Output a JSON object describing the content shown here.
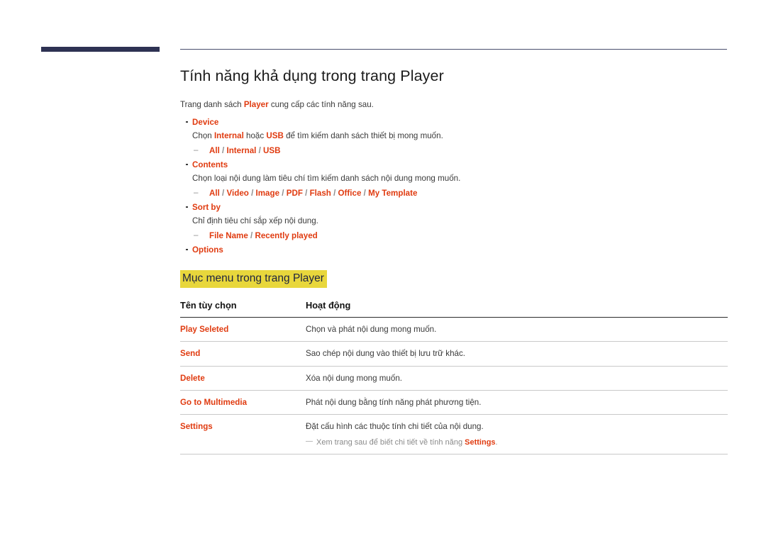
{
  "page": {
    "title": "Tính năng khả dụng trong trang Player",
    "intro_before": "Trang danh sách ",
    "intro_keyword": "Player",
    "intro_after": " cung cấp các tính năng sau."
  },
  "features": [
    {
      "title": "Device",
      "desc_parts": [
        {
          "text": "Chọn ",
          "style": "plain"
        },
        {
          "text": "Internal",
          "style": "red"
        },
        {
          "text": " hoặc ",
          "style": "plain"
        },
        {
          "text": "USB",
          "style": "red"
        },
        {
          "text": " để tìm kiếm danh sách thiết bị mong muốn.",
          "style": "plain"
        }
      ],
      "options": [
        "All",
        "Internal",
        "USB"
      ]
    },
    {
      "title": "Contents",
      "desc_parts": [
        {
          "text": "Chọn loại nội dung làm tiêu chí tìm kiếm danh sách nội dung mong muốn.",
          "style": "plain"
        }
      ],
      "options": [
        "All",
        "Video",
        "Image",
        "PDF",
        "Flash",
        "Office",
        "My Template"
      ]
    },
    {
      "title": "Sort by",
      "desc_parts": [
        {
          "text": "Chỉ định tiêu chí sắp xếp nội dung.",
          "style": "plain"
        }
      ],
      "options": [
        "File Name",
        "Recently played"
      ]
    },
    {
      "title": "Options",
      "desc_parts": [],
      "options": []
    }
  ],
  "section": {
    "heading": "Mục menu trong trang Player"
  },
  "table": {
    "headers": [
      "Tên tùy chọn",
      "Hoạt động"
    ],
    "rows": [
      {
        "name": "Play Seleted",
        "desc": "Chọn và phát nội dung mong muốn."
      },
      {
        "name": "Send",
        "desc": "Sao chép nội dung vào thiết bị lưu trữ khác."
      },
      {
        "name": "Delete",
        "desc": "Xóa nội dung mong muốn."
      },
      {
        "name": "Go to Multimedia",
        "desc": "Phát nội dung bằng tính năng phát phương tiện."
      },
      {
        "name": "Settings",
        "desc": "Đặt cấu hình các thuộc tính chi tiết của nội dung.",
        "note_before": "Xem trang sau để biết chi tiết về tính năng ",
        "note_keyword": "Settings",
        "note_after": "."
      }
    ]
  },
  "colors": {
    "accent_red": "#e03b10",
    "navy": "#2e3253",
    "highlight_yellow": "#e8d73c",
    "separator_gray": "#8d8d8d"
  }
}
